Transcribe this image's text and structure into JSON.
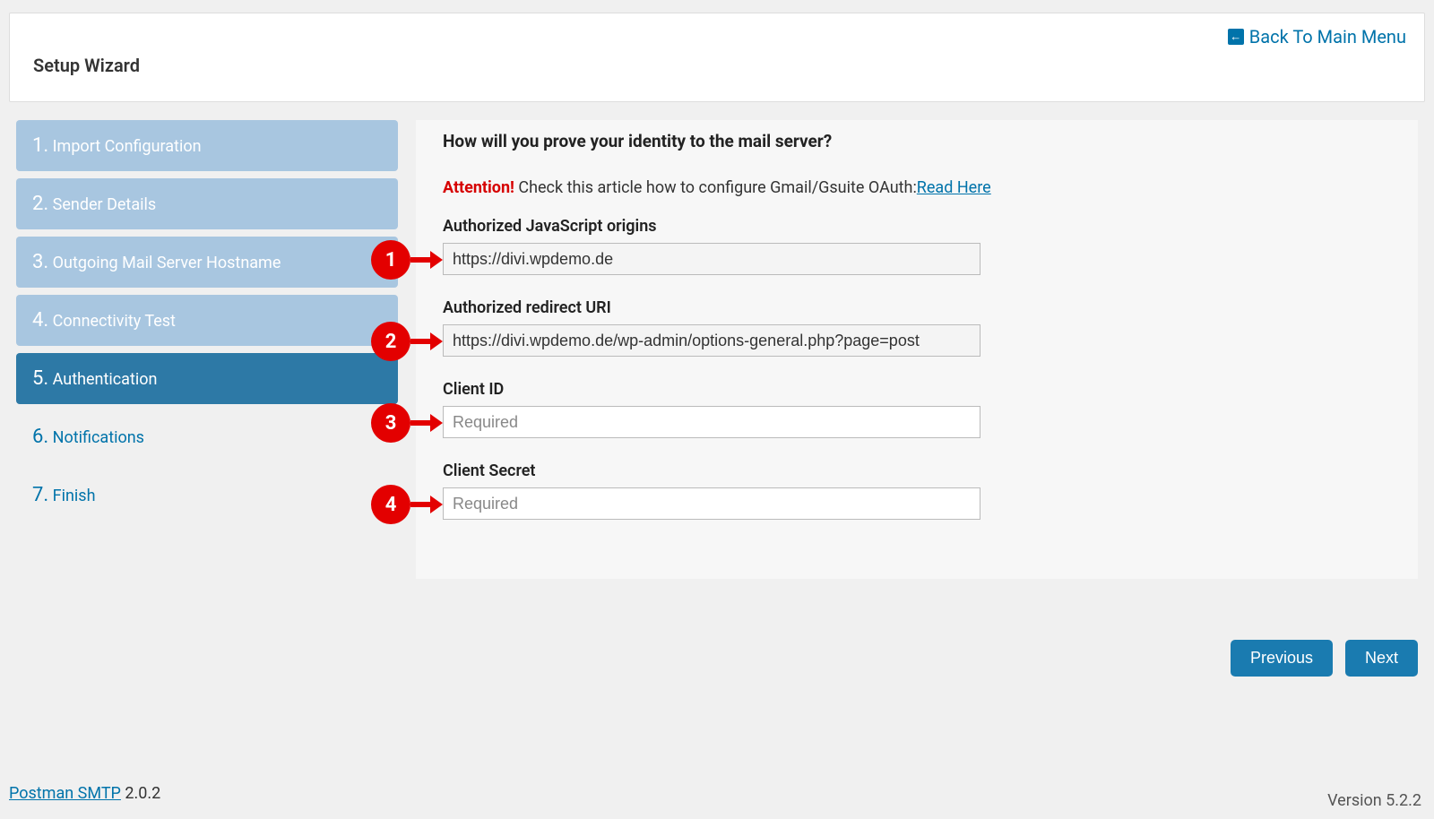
{
  "header": {
    "title": "Setup Wizard",
    "back_link": "Back To Main Menu"
  },
  "steps": [
    {
      "num": "1.",
      "label": "Import Configuration",
      "state": "done"
    },
    {
      "num": "2.",
      "label": "Sender Details",
      "state": "done"
    },
    {
      "num": "3.",
      "label": "Outgoing Mail Server Hostname",
      "state": "done"
    },
    {
      "num": "4.",
      "label": "Connectivity Test",
      "state": "done"
    },
    {
      "num": "5.",
      "label": "Authentication",
      "state": "active"
    },
    {
      "num": "6.",
      "label": "Notifications",
      "state": "future"
    },
    {
      "num": "7.",
      "label": "Finish",
      "state": "future"
    }
  ],
  "content": {
    "heading": "How will you prove your identity to the mail server?",
    "attention_label": "Attention!",
    "attention_text": " Check this article how to configure Gmail/Gsuite OAuth:",
    "read_here": "Read Here",
    "fields": {
      "js_origins": {
        "label": "Authorized JavaScript origins",
        "value": "https://divi.wpdemo.de"
      },
      "redirect_uri": {
        "label": "Authorized redirect URI",
        "value": "https://divi.wpdemo.de/wp-admin/options-general.php?page=post"
      },
      "client_id": {
        "label": "Client ID",
        "placeholder": "Required"
      },
      "client_secret": {
        "label": "Client Secret",
        "placeholder": "Required"
      }
    }
  },
  "markers": [
    "1",
    "2",
    "3",
    "4"
  ],
  "buttons": {
    "previous": "Previous",
    "next": "Next"
  },
  "footer": {
    "product": "Postman SMTP",
    "product_version": " 2.0.2",
    "wp_version": "Version 5.2.2"
  }
}
